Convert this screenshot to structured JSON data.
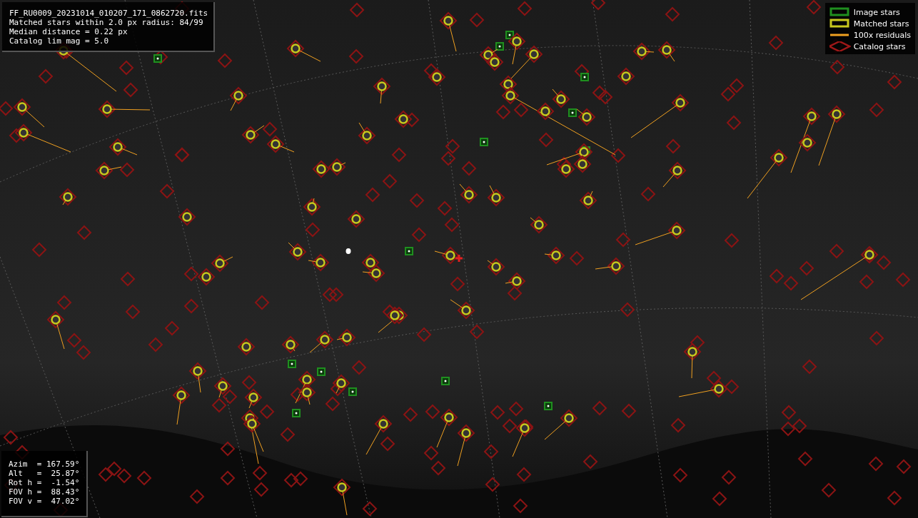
{
  "info_box": {
    "lines": [
      "FF_RU0009_20231014_010207_171_0862720.fits",
      "Matched stars within 2.0 px radius: 84/99",
      "Median distance = 0.22 px",
      "Catalog lim mag = 5.0"
    ]
  },
  "legend": [
    {
      "kind": "image",
      "label": "Image stars",
      "color": "#1f8f1f"
    },
    {
      "kind": "matched",
      "label": "Matched stars",
      "color": "#c8c81e"
    },
    {
      "kind": "residual",
      "label": "100x residuals",
      "color": "#f0a020"
    },
    {
      "kind": "catalog",
      "label": "Catalog stars",
      "color": "#a01818"
    }
  ],
  "pointing_box": {
    "lines": [
      "Azim  = 167.59°",
      "Alt   =  25.87°",
      "Rot h =  -1.54°",
      "FOV h =  88.43°",
      "FOV v =  47.02°"
    ]
  }
}
